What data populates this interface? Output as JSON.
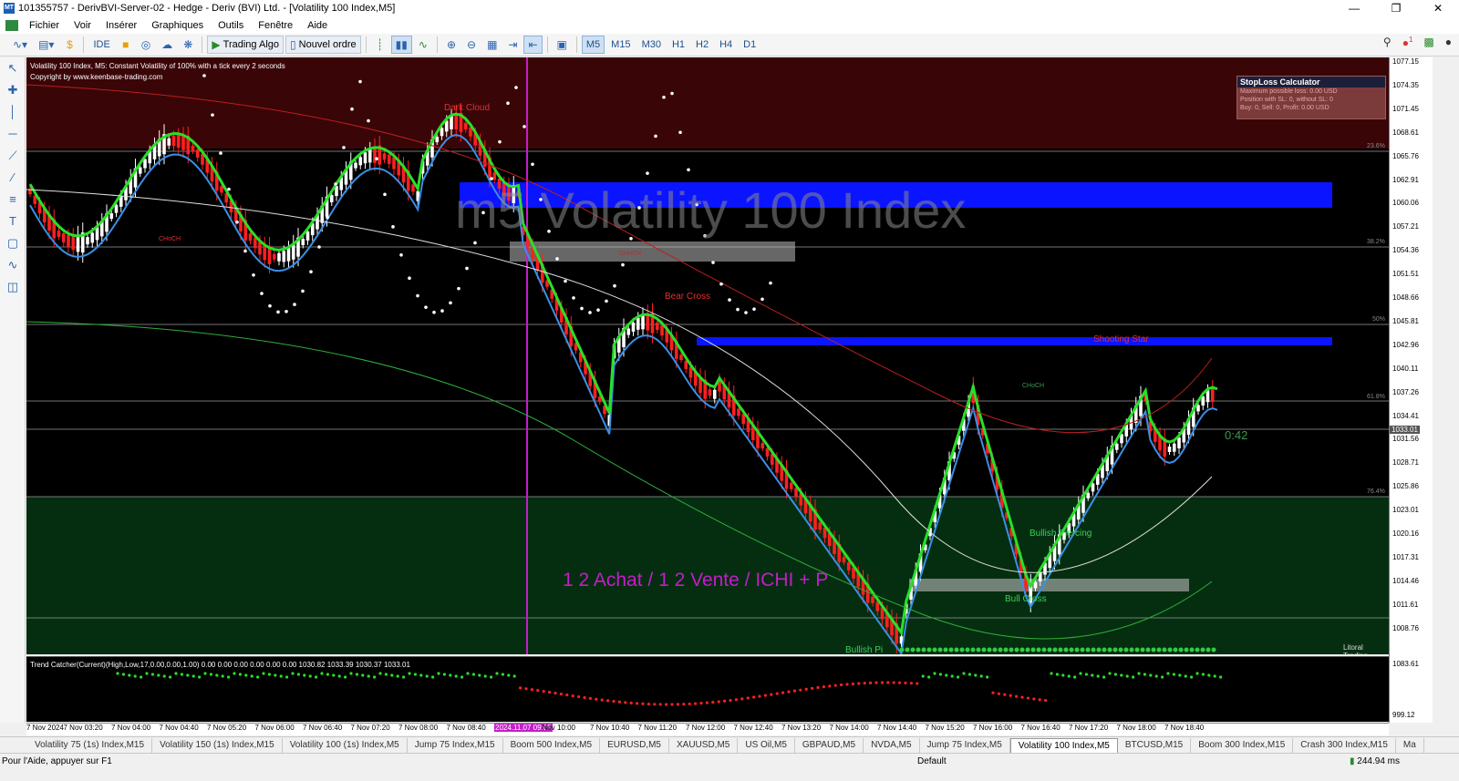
{
  "window": {
    "title": "101355757 - DerivBVI-Server-02 - Hedge - Deriv (BVI) Ltd. - [Volatility 100 Index,M5]"
  },
  "menu": [
    "Fichier",
    "Voir",
    "Insérer",
    "Graphiques",
    "Outils",
    "Fenêtre",
    "Aide"
  ],
  "toolbar": {
    "ide_label": "IDE",
    "algo_label": "Trading Algo",
    "order_label": "Nouvel ordre",
    "timeframes": [
      "M5",
      "M15",
      "M30",
      "H1",
      "H2",
      "H4",
      "D1"
    ],
    "active_timeframe": "M5",
    "notification_count": "1"
  },
  "chart": {
    "title": "Volatility 100 Index, M5:  Constant Volatility of 100% with a tick every 2 seconds",
    "copyright": "Copyright by www.keenbase-trading.com",
    "watermark": "m5 Volatility 100 Index",
    "strategy_text": "1 2 Achat / 1 2 Vente / ICHI + P",
    "timer": "0:42",
    "credit": "Litoral Trading",
    "stoploss": {
      "title": "StopLoss Calculator",
      "line1": "Maximum possible loss: 0.00 USD",
      "line2": "Position with SL: 0, without SL: 0",
      "line3": "Buy: 0, Sell: 0, Profit: 0.00 USD"
    },
    "annotations": {
      "dark_cloud": "Dark Cloud",
      "bear_cross": "Bear Cross",
      "shooting_star": "Shooting Star",
      "bullish_piercing": "Bullish Piercing",
      "bull_cross": "Bull Cross",
      "bullish_p": "Bullish Pi",
      "choch": "CHoCH",
      "choch2": "CHoCH",
      "choch3": "CHoCH",
      "fib_236": "23.6%",
      "fib_382": "38.2%",
      "fib_50": "50%",
      "fib_618": "61.8%",
      "fib_764": "76.4%"
    },
    "price_labels": [
      "1077.15",
      "1074.35",
      "1071.45",
      "1068.61",
      "1065.76",
      "1062.91",
      "1060.06",
      "1057.21",
      "1054.36",
      "1051.51",
      "1048.66",
      "1045.81",
      "1042.96",
      "1040.11",
      "1037.26",
      "1034.41",
      "1031.56",
      "1028.71",
      "1025.86",
      "1023.01",
      "1020.16",
      "1017.31",
      "1014.46",
      "1011.61",
      "1008.76"
    ],
    "current_price": "1033.01",
    "indicator_label": "Trend Catcher(Current)(High,Low,17,0.00,0.00,1.00) 0.00 0.00 0.00 0.00 0.00 0.00 1030.82 1033.39 1030.37 1033.01",
    "indicator_axis": [
      "1083.61",
      "999.12"
    ],
    "time_labels": [
      "7 Nov 2024",
      "7 Nov 03:20",
      "7 Nov 04:00",
      "7 Nov 04:40",
      "7 Nov 05:20",
      "7 Nov 06:00",
      "7 Nov 06:40",
      "7 Nov 07:20",
      "7 Nov 08:00",
      "7 Nov 08:40",
      "2024.11.07 09:05",
      "Nov 10:00",
      "7 Nov 10:40",
      "7 Nov 11:20",
      "7 Nov 12:00",
      "7 Nov 12:40",
      "7 Nov 13:20",
      "7 Nov 14:00",
      "7 Nov 14:40",
      "7 Nov 15:20",
      "7 Nov 16:00",
      "7 Nov 16:40",
      "7 Nov 17:20",
      "7 Nov 18:00",
      "7 Nov 18:40"
    ]
  },
  "tabs": [
    "Volatility 75 (1s) Index,M15",
    "Volatility 150 (1s) Index,M15",
    "Volatility 100 (1s) Index,M5",
    "Jump 75 Index,M15",
    "Boom 500 Index,M5",
    "EURUSD,M5",
    "XAUUSD,M5",
    "US Oil,M5",
    "GBPAUD,M5",
    "NVDA,M5",
    "Jump 75 Index,M5",
    "Volatility 100 Index,M5",
    "BTCUSD,M15",
    "Boom 300 Index,M15",
    "Crash 300 Index,M15",
    "Ma"
  ],
  "active_tab": "Volatility 100 Index,M5",
  "status": {
    "help": "Pour l'Aide, appuyer sur F1",
    "profile": "Default",
    "ping": "244.94 ms"
  },
  "colors": {
    "bull": "#28e028",
    "bear": "#ff2020",
    "ma_blue": "#3a8fe8",
    "magenta": "#c21ec8",
    "zone_blue": "#0a14ff"
  }
}
